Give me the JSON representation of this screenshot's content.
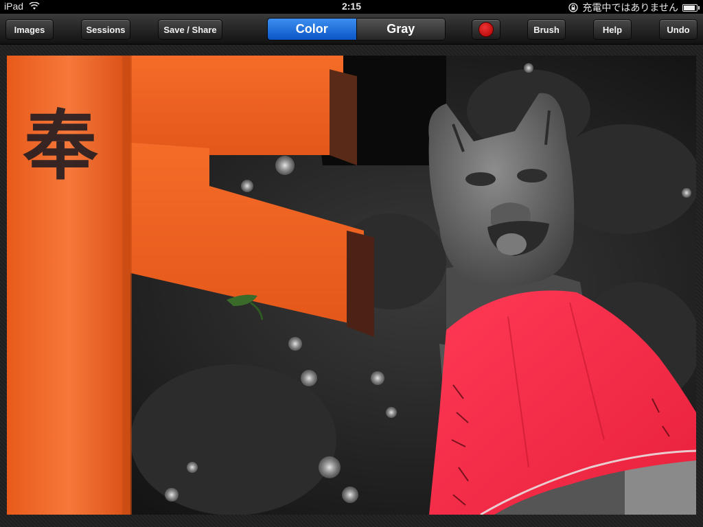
{
  "status_bar": {
    "device": "iPad",
    "time": "2:15",
    "charging_text": "充電中ではありません",
    "icons": [
      "wifi-icon",
      "rotation-lock-icon",
      "battery-icon"
    ]
  },
  "toolbar": {
    "images_label": "Images",
    "sessions_label": "Sessions",
    "save_share_label": "Save / Share",
    "color_label": "Color",
    "gray_label": "Gray",
    "selected_mode": "Color",
    "brush_color": "#c00000",
    "brush_label": "Brush",
    "help_label": "Help",
    "undo_label": "Undo"
  },
  "photo": {
    "torii_kanji": "奉",
    "colors": {
      "torii": "#f06a2a",
      "bib": "#f0324a",
      "accent": "#0a55c6"
    }
  }
}
